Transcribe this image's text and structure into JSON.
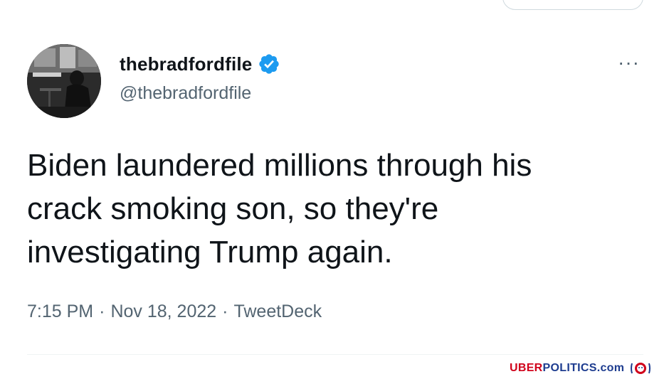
{
  "tweet": {
    "display_name": "thebradfordfile",
    "handle": "@thebradfordfile",
    "text": "Biden laundered millions through his\ncrack smoking son, so they're\ninvestigating Trump again.",
    "time": "7:15 PM",
    "separator": "·",
    "date": "Nov 18, 2022",
    "source": "TweetDeck",
    "more_label": "···"
  },
  "watermark": {
    "uber": "UBER",
    "rest": "POLITICS.com"
  },
  "colors": {
    "verified": "#1d9bf0",
    "secondary_text": "#536471",
    "watermark_red": "#d0021b",
    "watermark_blue": "#1d3c8f"
  },
  "icons": {
    "verified": "verified-badge-icon",
    "more": "more-options-icon",
    "watermark_logo": "uberpolitics-logo-icon"
  }
}
